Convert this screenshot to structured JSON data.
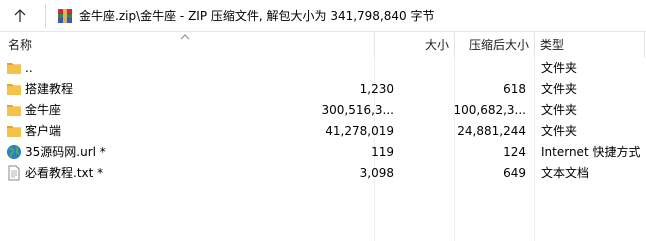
{
  "address": {
    "path": "金牛座.zip\\金牛座 - ZIP 压缩文件, 解包大小为 341,798,840 字节"
  },
  "icons": {
    "up": "arrow-up-icon",
    "archive": "winrar-archive-icon",
    "folder": "folder-icon",
    "url": "globe-icon",
    "txt": "text-file-icon"
  },
  "columns": {
    "name": "名称",
    "size": "大小",
    "compressed": "压缩后大小",
    "type": "类型"
  },
  "files": [
    {
      "name": "..",
      "size": "",
      "compressed": "",
      "type": "文件夹",
      "icon": "folder"
    },
    {
      "name": "搭建教程",
      "size": "1,230",
      "compressed": "618",
      "type": "文件夹",
      "icon": "folder"
    },
    {
      "name": "金牛座",
      "size": "300,516,3...",
      "compressed": "100,682,3...",
      "type": "文件夹",
      "icon": "folder"
    },
    {
      "name": "客户端",
      "size": "41,278,019",
      "compressed": "24,881,244",
      "type": "文件夹",
      "icon": "folder"
    },
    {
      "name": "35源码网.url *",
      "size": "119",
      "compressed": "124",
      "type": "Internet 快捷方式",
      "icon": "url"
    },
    {
      "name": "必看教程.txt *",
      "size": "3,098",
      "compressed": "649",
      "type": "文本文档",
      "icon": "txt"
    }
  ],
  "colors": {
    "folder": "#f5c24c",
    "folder_dark": "#e0a52a",
    "divider": "#e5e5e5"
  }
}
